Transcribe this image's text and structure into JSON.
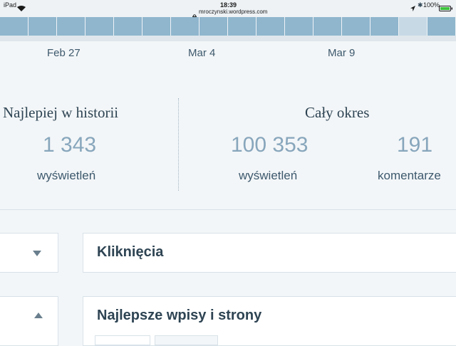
{
  "status_bar": {
    "device": "iPad",
    "time": "18:39",
    "url": "mroczynski.wordpress.com",
    "battery": "100%"
  },
  "chart_strip": {
    "x_ticks": [
      "Feb 27",
      "Mar 4",
      "Mar 9"
    ],
    "bar_count": 16,
    "highlighted_bar_index": 14,
    "bar_color": "#8fb6cd",
    "highlight_color": "#c7d9e5"
  },
  "stats": {
    "best": {
      "title": "Najlepiej w historii",
      "value": "1 343",
      "label": "wyświetleń"
    },
    "all_time": {
      "title": "Cały okres",
      "views_value": "100 353",
      "views_label": "wyświetleń",
      "comments_value": "191",
      "comments_label": "komentarze"
    }
  },
  "cards": {
    "clicks": {
      "title": "Kliknięcia"
    },
    "top_posts": {
      "title": "Najlepsze wpisy i strony"
    }
  }
}
